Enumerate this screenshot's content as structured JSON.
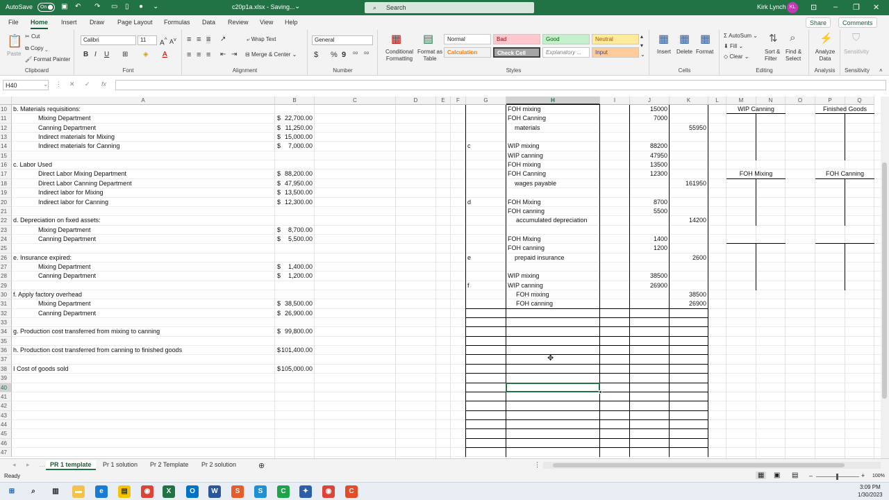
{
  "titlebar": {
    "autosave": "AutoSave",
    "autosave_state": "On",
    "filename": "c20p1a.xlsx - Saving...",
    "search": "Search",
    "user": "Kirk Lynch",
    "initials": "KL"
  },
  "tabs": [
    "File",
    "Home",
    "Insert",
    "Draw",
    "Page Layout",
    "Formulas",
    "Data",
    "Review",
    "View",
    "Help"
  ],
  "active_tab": "Home",
  "share": "Share",
  "comments": "Comments",
  "ribbon": {
    "clipboard": {
      "label": "Clipboard",
      "paste": "Paste",
      "cut": "Cut",
      "copy": "Copy",
      "format_painter": "Format Painter"
    },
    "font": {
      "label": "Font",
      "name": "Calibri",
      "size": "11",
      "bold": "B",
      "italic": "I",
      "underline": "U"
    },
    "alignment": {
      "label": "Alignment",
      "wrap": "Wrap Text",
      "merge": "Merge & Center"
    },
    "number": {
      "label": "Number",
      "format": "General",
      "currency": "$",
      "percent": "%",
      "comma": "9"
    },
    "styles": {
      "label": "Styles",
      "conditional": "Conditional Formatting",
      "format_table": "Format as Table",
      "normal": "Normal",
      "bad": "Bad",
      "good": "Good",
      "neutral": "Neutral",
      "calculation": "Calculation",
      "check_cell": "Check Cell",
      "explanatory": "Explanatory ...",
      "input": "Input"
    },
    "cells": {
      "label": "Cells",
      "insert": "Insert",
      "delete": "Delete",
      "format": "Format"
    },
    "editing": {
      "label": "Editing",
      "autosum": "AutoSum",
      "fill": "Fill",
      "clear": "Clear",
      "sort": "Sort & Filter",
      "find": "Find & Select"
    },
    "analysis": {
      "label": "Analysis",
      "analyze": "Analyze Data"
    },
    "sensitivity": {
      "label": "Sensitivity",
      "btn": "Sensitivity"
    }
  },
  "formula": {
    "namebox": "H40",
    "cancel": "✕",
    "enter": "✓",
    "fx": "fx",
    "content": ""
  },
  "columns": [
    "A",
    "B",
    "C",
    "D",
    "E",
    "F",
    "G",
    "H",
    "I",
    "J",
    "K",
    "L",
    "M",
    "N",
    "O",
    "P",
    "Q"
  ],
  "selected_column": "H",
  "rows": [
    "10",
    "11",
    "12",
    "13",
    "14",
    "15",
    "16",
    "17",
    "18",
    "19",
    "20",
    "21",
    "22",
    "23",
    "24",
    "25",
    "26",
    "27",
    "28",
    "29",
    "30",
    "31",
    "32",
    "33",
    "34",
    "35",
    "36",
    "37",
    "38",
    "39",
    "40",
    "41",
    "42",
    "43",
    "44",
    "45",
    "46",
    "47"
  ],
  "selected_row": "40",
  "colA": {
    "10": "b. Materials requisitions:",
    "11": "Mixing Department",
    "12": "Canning Department",
    "13": "Indirect materials for Mixing",
    "14": "Indirect materials for Canning",
    "16": "c. Labor Used",
    "17": "Direct Labor Mixing Department",
    "18": "Direct Labor Canning Department",
    "19": "Indirect labor for Mixing",
    "20": "Indirect labor for Canning",
    "22": "d. Depreciation on fixed assets:",
    "23": "Mixing Department",
    "24": "Canning Department",
    "26": "e. Insurance expired:",
    "27": "Mixing Department",
    "28": "Canning Department",
    "30": "f. Apply factory overhead",
    "31": "Mixing Department",
    "32": "Canning Department",
    "34": "g. Production cost transferred from mixing to canning",
    "36": "h. Production cost transferred from canning to finished goods",
    "38": "I Cost of goods sold"
  },
  "colB": {
    "11": "22,700.00",
    "12": "11,250.00",
    "13": "15,000.00",
    "14": "7,000.00",
    "17": "88,200.00",
    "18": "47,950.00",
    "19": "13,500.00",
    "20": "12,300.00",
    "23": "8,700.00",
    "24": "5,500.00",
    "27": "1,400.00",
    "28": "1,200.00",
    "31": "38,500.00",
    "32": "26,900.00",
    "34": "99,800.00",
    "36": "101,400.00",
    "38": "105,000.00"
  },
  "currency": "$",
  "colG": {
    "14": "c",
    "20": "d",
    "26": "e",
    "29": "f"
  },
  "colH": {
    "10": "FOH mixing",
    "11": "FOH Canning",
    "12": "materials",
    "14": "WIP mixing",
    "15": "WIP canning",
    "16": "FOH mixing",
    "17": "FOH Canning",
    "18": "wages payable",
    "20": "FOH Mixing",
    "21": "FOH canning",
    "22": "accumulated depreciation",
    "24": "FOH Mixing",
    "25": "FOH canning",
    "26": "prepaid insurance",
    "28": "WIP mixing",
    "29": "WIP canning",
    "30": "FOH mixing",
    "31": "FOH canning"
  },
  "colJ": {
    "10": "15000",
    "11": "7000",
    "14": "88200",
    "15": "47950",
    "16": "13500",
    "17": "12300",
    "20": "8700",
    "21": "5500",
    "24": "1400",
    "25": "1200",
    "28": "38500",
    "29": "26900"
  },
  "colK": {
    "12": "55950",
    "18": "161950",
    "22": "14200",
    "26": "2600",
    "30": "38500",
    "31": "26900"
  },
  "taccounts": {
    "wip_canning": "WIP Canning",
    "finished_goods": "Finished Goods",
    "foh_mixing": "FOH Mixing",
    "foh_canning": "FOH Canning"
  },
  "sheets": [
    "PR 1 template",
    "Pr 1 solution",
    "Pr 2 Template",
    "Pr 2 solution"
  ],
  "active_sheet": "PR 1 template",
  "status": {
    "ready": "Ready",
    "zoom": "100%"
  },
  "clock": {
    "time": "3:09 PM",
    "date": "1/30/2023"
  }
}
